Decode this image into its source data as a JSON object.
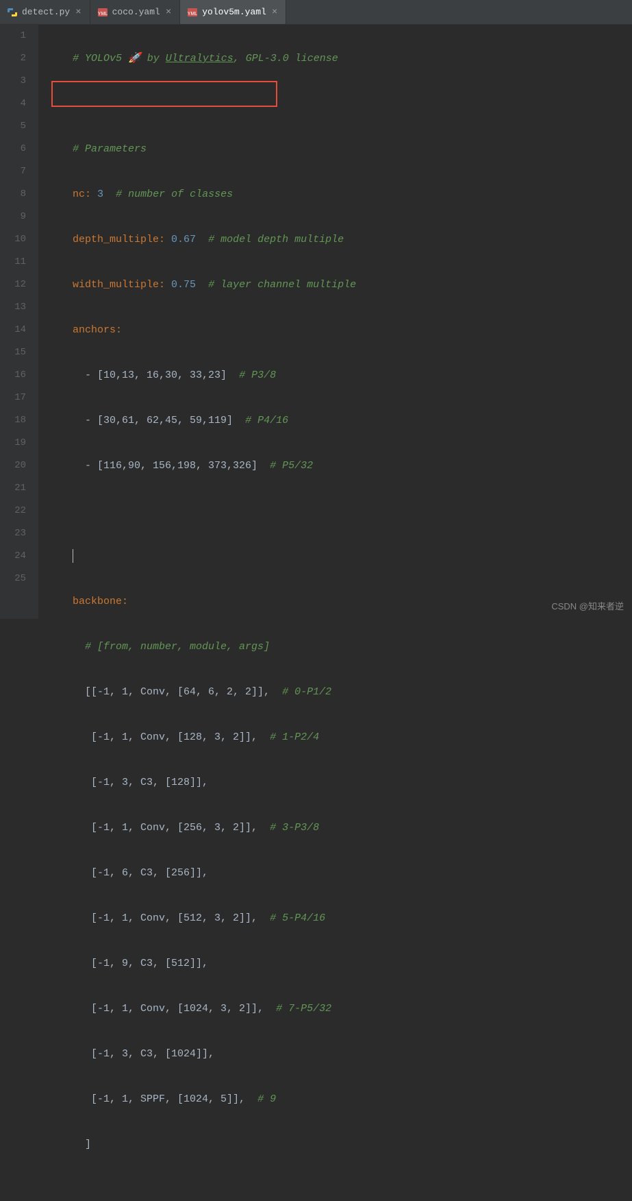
{
  "tabs": [
    {
      "label": "detect.py",
      "icon": "python-icon",
      "active": false
    },
    {
      "label": "coco.yaml",
      "icon": "yaml-icon",
      "active": false
    },
    {
      "label": "yolov5m.yaml",
      "icon": "yaml-icon",
      "active": true
    }
  ],
  "line_numbers": [
    "1",
    "2",
    "3",
    "4",
    "5",
    "6",
    "7",
    "8",
    "9",
    "10",
    "11",
    "12",
    "13",
    "14",
    "15",
    "16",
    "17",
    "18",
    "19",
    "20",
    "21",
    "22",
    "23",
    "24",
    "25",
    ""
  ],
  "code": {
    "l1": {
      "comment": "# YOLOv5 🚀 by ",
      "link": "Ultralytics",
      "rest": ", GPL-3.0 license"
    },
    "l3": {
      "comment": "# Parameters"
    },
    "l4": {
      "key": "nc",
      "val": "3",
      "comment": "# number of classes"
    },
    "l5": {
      "key": "depth_multiple",
      "val": "0.67",
      "comment": "# model depth multiple"
    },
    "l6": {
      "key": "width_multiple",
      "val": "0.75",
      "comment": "# layer channel multiple"
    },
    "l7": {
      "key": "anchors"
    },
    "l8": {
      "arr": "- [10,13, 16,30, 33,23]",
      "comment": "# P3/8"
    },
    "l9": {
      "arr": "- [30,61, 62,45, 59,119]",
      "comment": "# P4/16"
    },
    "l10": {
      "arr": "- [116,90, 156,198, 373,326]",
      "comment": "# P5/32"
    },
    "l13": {
      "key": "backbone"
    },
    "l14": {
      "comment": "# [from, number, module, args]"
    },
    "l15": {
      "txt": "[[-1, 1, Conv, [64, 6, 2, 2]],",
      "comment": "# 0-P1/2"
    },
    "l16": {
      "txt": " [-1, 1, Conv, [128, 3, 2]],",
      "comment": "# 1-P2/4"
    },
    "l17": {
      "txt": " [-1, 3, C3, [128]],"
    },
    "l18": {
      "txt": " [-1, 1, Conv, [256, 3, 2]],",
      "comment": "# 3-P3/8"
    },
    "l19": {
      "txt": " [-1, 6, C3, [256]],"
    },
    "l20": {
      "txt": " [-1, 1, Conv, [512, 3, 2]],",
      "comment": "# 5-P4/16"
    },
    "l21": {
      "txt": " [-1, 9, C3, [512]],"
    },
    "l22": {
      "txt": " [-1, 1, Conv, [1024, 3, 2]],",
      "comment": "# 7-P5/32"
    },
    "l23": {
      "txt": " [-1, 3, C3, [1024]],"
    },
    "l24": {
      "txt": " [-1, 1, SPPF, [1024, 5]],",
      "comment": "# 9"
    },
    "l25": {
      "txt": "]"
    }
  },
  "watermark": "CSDN @知来者逆"
}
